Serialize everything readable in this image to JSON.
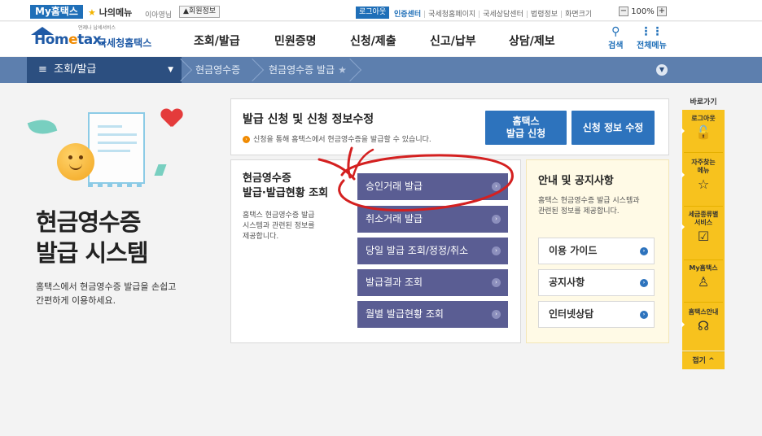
{
  "util": {
    "my_tab": "My홈택스",
    "my_menu": "나의메뉴",
    "greeting": "이아영님",
    "member_info": "회원정보",
    "logout": "로그아웃",
    "links": [
      "인증센터",
      "국세청홈페이지",
      "국세상담센터",
      "법령정보",
      "화면크기"
    ],
    "zoom_minus": "−",
    "zoom_value": "100%",
    "zoom_plus": "+"
  },
  "logo": {
    "sub": "언제나 납세서비스",
    "main_a": "Hom",
    "main_b": "e",
    "main_c": "tax.",
    "kr": "국세청홈택스"
  },
  "nav": [
    "조회/발급",
    "민원증명",
    "신청/제출",
    "신고/납부",
    "상담/제보"
  ],
  "gnb_util": {
    "search": "검색",
    "all_menu": "전체메뉴"
  },
  "location": {
    "home": "조회/발급",
    "crumb1": "현금영수증",
    "crumb2": "현금영수증 발급"
  },
  "hero": {
    "title_line1": "현금영수증",
    "title_line2": "발급 시스템",
    "desc_line1": "홈택스에서 현금영수증 발급을 손쉽고",
    "desc_line2": "간편하게 이용하세요."
  },
  "issue": {
    "title": "발급 신청 및 신청 정보수정",
    "desc": "신청을 통해 홈택스에서 현금영수증을 발급할 수 있습니다.",
    "btn_apply_line1": "홈택스",
    "btn_apply_line2": "발급 신청",
    "btn_modify": "신청 정보 수정"
  },
  "inquiry": {
    "title_line1": "현금영수증",
    "title_line2": "발급·발급현황 조회",
    "desc_line1": "홈택스 현금영수증 발급",
    "desc_line2": "시스템과 관련된 정보를",
    "desc_line3": "제공합니다.",
    "buttons": [
      "승인거래 발급",
      "취소거래 발급",
      "당일 발급 조회/정정/취소",
      "발급결과 조회",
      "월별 발급현황 조회"
    ]
  },
  "guide": {
    "title": "안내 및 공지사항",
    "desc_line1": "홈택스 현금영수증 발급 시스템과",
    "desc_line2": "관련된 정보를 제공합니다.",
    "buttons": [
      "이용 가이드",
      "공지사항",
      "인터넷상담"
    ]
  },
  "quick": {
    "head": "바로가기",
    "items": [
      {
        "label_line1": "로그아웃",
        "label_line2": ""
      },
      {
        "label_line1": "자주찾는",
        "label_line2": "메뉴"
      },
      {
        "label_line1": "세금종류별",
        "label_line2": "서비스"
      },
      {
        "label_line1": "My홈택스",
        "label_line2": ""
      },
      {
        "label_line1": "홈택스안내",
        "label_line2": ""
      }
    ],
    "close": "접기 ^"
  },
  "colors": {
    "brand_blue": "#2d73bd",
    "nav_bar": "#5d7fae",
    "purple_button": "#5a5d93",
    "quick_yellow": "#f7c21e",
    "annotation_red": "#d42020"
  }
}
